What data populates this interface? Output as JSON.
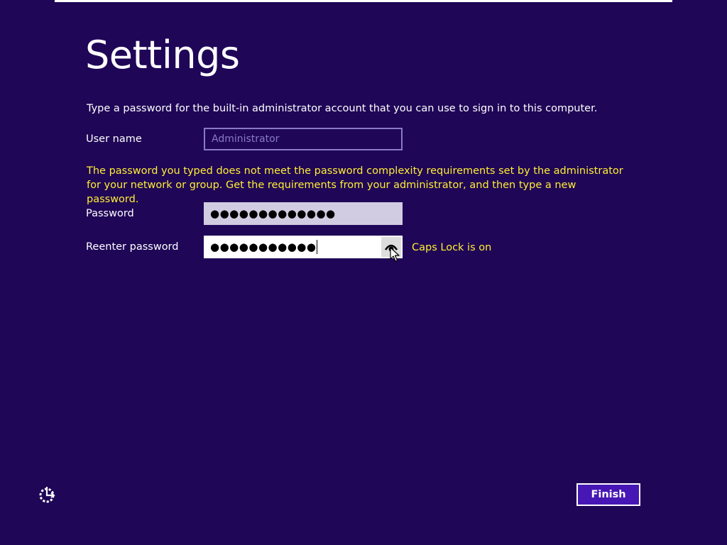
{
  "header": {
    "title": "Settings"
  },
  "intro_text": "Type a password for the built-in administrator account that you can use to sign in to this computer.",
  "form": {
    "username_label": "User name",
    "username_placeholder": "Administrator",
    "warning_text": "The password you typed does not meet the password complexity requirements set by the administrator for your network or group. Get the requirements from your administrator, and then type a new password.",
    "password_label": "Password",
    "password_value": "●●●●●●●●●●●●●",
    "reenter_label": "Reenter password",
    "reenter_value": "●●●●●●●●●●●",
    "reveal_icon": "eye-icon",
    "caps_lock_text": "Caps Lock is on"
  },
  "footer": {
    "ease_of_access_icon": "ease-of-access-icon",
    "finish_label": "Finish"
  },
  "colors": {
    "background": "#1f0657",
    "warning": "#ffee33",
    "finish_button": "#4617b4"
  }
}
